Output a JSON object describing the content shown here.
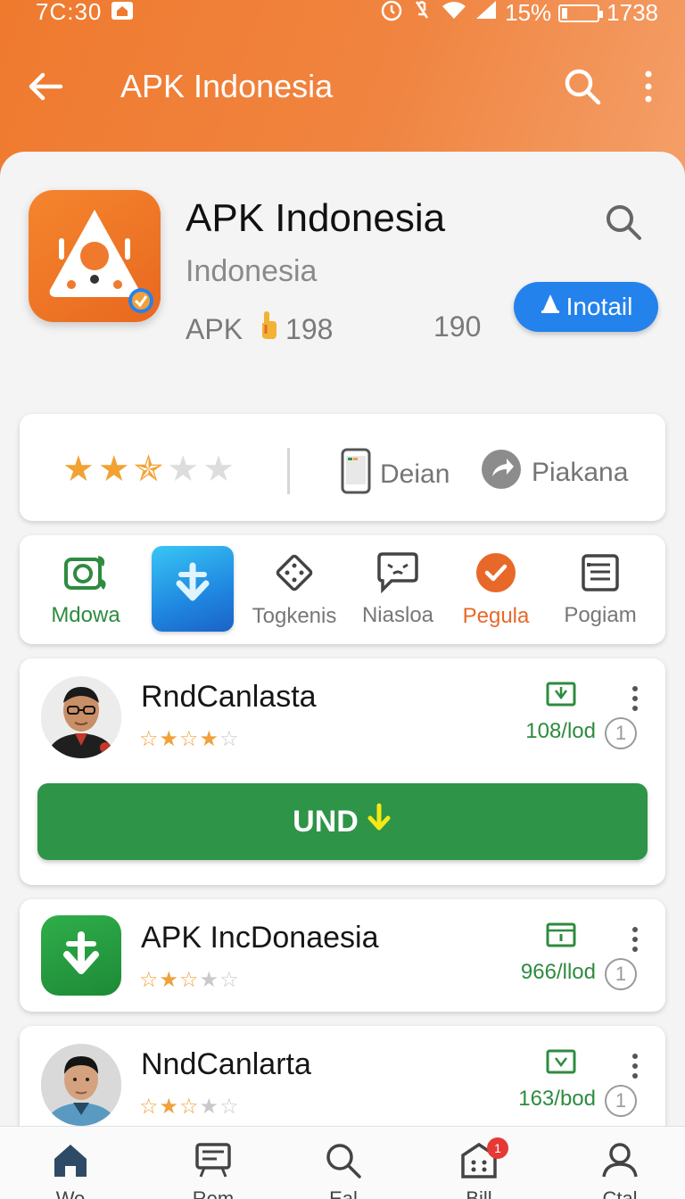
{
  "status_bar": {
    "time": "7C:30",
    "battery_text": "15%",
    "battery_level": 0.15,
    "right_number": "1738"
  },
  "app_bar": {
    "title": "APK Indonesia",
    "icons": [
      "back-arrow-icon",
      "search-icon",
      "more-vert-icon"
    ]
  },
  "app_header": {
    "name": "APK Indonesia",
    "subtitle": "Indonesia",
    "meta_label": "APK",
    "meta_count": "198",
    "meta_count_2": "190",
    "install_label": "Inotail",
    "accent_color": "#ef7a2e",
    "install_color": "#2482ec"
  },
  "rating_row": {
    "rating": 2.5,
    "stats": [
      {
        "label": "Deian",
        "icon": "phone-icon"
      },
      {
        "label": "Piakana",
        "icon": "share-arrow-icon"
      }
    ]
  },
  "categories": [
    {
      "label": "Mdowa",
      "icon": "camera-leaf-icon",
      "color": "#2e8b3f",
      "active": false
    },
    {
      "label": "",
      "icon": "download-arrow-icon",
      "featured": true
    },
    {
      "label": "Togkenis",
      "icon": "dice-icon",
      "color": "#777777",
      "active": false
    },
    {
      "label": "Niasloa",
      "icon": "chat-bubble-icon",
      "color": "#777777",
      "active": false
    },
    {
      "label": "Pegula",
      "icon": "check-circle-icon",
      "color": "#e8682a",
      "active": true
    },
    {
      "label": "Pogiam",
      "icon": "list-doc-icon",
      "color": "#777777",
      "active": false
    }
  ],
  "list_items": [
    {
      "title": "RndCanlasta",
      "stars": 3.5,
      "downloads": "108/lod",
      "count": "1",
      "avatar": "person-glasses-avatar",
      "action_label": "UND"
    },
    {
      "title": "APK IncDonaesia",
      "stars": 2.5,
      "downloads": "966/llod",
      "count": "1",
      "avatar": "green-download-app-icon"
    },
    {
      "title": "NndCanlarta",
      "stars": 2.5,
      "downloads": "163/bod",
      "count": "1",
      "avatar": "person-avatar"
    }
  ],
  "bottom_nav": [
    {
      "label": "Wo",
      "icon": "home-icon",
      "active": true
    },
    {
      "label": "Rem",
      "icon": "feed-icon"
    },
    {
      "label": "Eal",
      "icon": "search-icon"
    },
    {
      "label": "Bill",
      "icon": "apps-box-icon",
      "badge": "1"
    },
    {
      "label": "Ctal",
      "icon": "profile-icon"
    }
  ]
}
